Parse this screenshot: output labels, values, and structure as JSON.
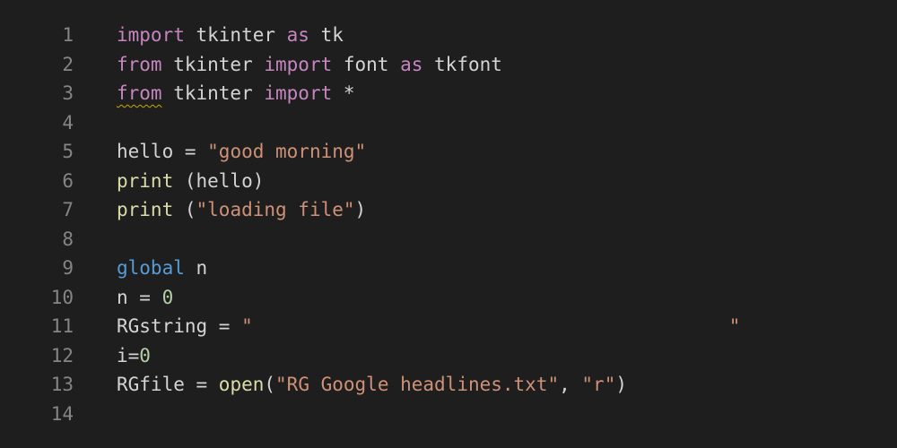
{
  "editor": {
    "lines": [
      {
        "num": "1",
        "tokens": [
          {
            "t": "import",
            "c": "kw"
          },
          {
            "t": " tkinter ",
            "c": "id"
          },
          {
            "t": "as",
            "c": "kw"
          },
          {
            "t": " tk",
            "c": "id"
          }
        ]
      },
      {
        "num": "2",
        "tokens": [
          {
            "t": "from",
            "c": "kw"
          },
          {
            "t": " tkinter ",
            "c": "id"
          },
          {
            "t": "import",
            "c": "kw"
          },
          {
            "t": " font ",
            "c": "id"
          },
          {
            "t": "as",
            "c": "kw"
          },
          {
            "t": " tkfont",
            "c": "id"
          }
        ]
      },
      {
        "num": "3",
        "tokens": [
          {
            "t": "from",
            "c": "kw squiggle"
          },
          {
            "t": " tkinter ",
            "c": "id"
          },
          {
            "t": "import",
            "c": "kw"
          },
          {
            "t": " *",
            "c": "op"
          }
        ]
      },
      {
        "num": "4",
        "tokens": []
      },
      {
        "num": "5",
        "tokens": [
          {
            "t": "hello = ",
            "c": "id"
          },
          {
            "t": "\"good morning\"",
            "c": "str"
          }
        ]
      },
      {
        "num": "6",
        "tokens": [
          {
            "t": "print",
            "c": "fn"
          },
          {
            "t": " (hello)",
            "c": "id"
          }
        ]
      },
      {
        "num": "7",
        "tokens": [
          {
            "t": "print",
            "c": "fn"
          },
          {
            "t": " (",
            "c": "id"
          },
          {
            "t": "\"loading file\"",
            "c": "str"
          },
          {
            "t": ")",
            "c": "id"
          }
        ]
      },
      {
        "num": "8",
        "tokens": []
      },
      {
        "num": "9",
        "tokens": [
          {
            "t": "global",
            "c": "kwb"
          },
          {
            "t": " n",
            "c": "id"
          }
        ]
      },
      {
        "num": "10",
        "tokens": [
          {
            "t": "n = ",
            "c": "id"
          },
          {
            "t": "0",
            "c": "num"
          }
        ]
      },
      {
        "num": "11",
        "tokens": [
          {
            "t": "RGstring = ",
            "c": "id"
          },
          {
            "t": "\"                                          \"",
            "c": "str"
          }
        ]
      },
      {
        "num": "12",
        "tokens": [
          {
            "t": "i=",
            "c": "id"
          },
          {
            "t": "0",
            "c": "num"
          }
        ]
      },
      {
        "num": "13",
        "tokens": [
          {
            "t": "RGfile = ",
            "c": "id"
          },
          {
            "t": "open",
            "c": "fn"
          },
          {
            "t": "(",
            "c": "id"
          },
          {
            "t": "\"RG Google headlines.txt\"",
            "c": "str"
          },
          {
            "t": ", ",
            "c": "id"
          },
          {
            "t": "\"r\"",
            "c": "str"
          },
          {
            "t": ")",
            "c": "id"
          }
        ]
      },
      {
        "num": "14",
        "tokens": []
      }
    ]
  }
}
